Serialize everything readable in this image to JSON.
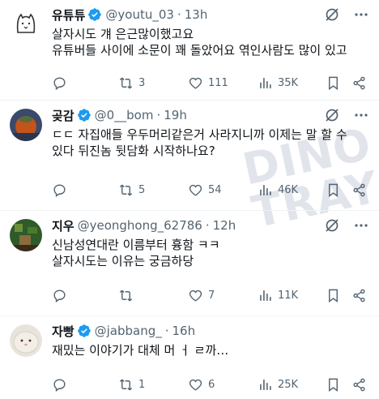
{
  "tweets": [
    {
      "name": "유튜튜",
      "handle": "@youtu_03",
      "time": "13h",
      "lines": [
        "살자시도 걔 은근많이했고요",
        "유튜버들 사이에 소문이 꽤 돌았어요 엮인사람도 많이 있고"
      ],
      "reply_count": "",
      "repost_count": "3",
      "like_count": "111",
      "view_count": "35K"
    },
    {
      "name": "곶감",
      "handle": "@0__bom",
      "time": "19h",
      "lines": [
        "ㄷㄷ 자집애들 우두머리같은거 사라지니까 이제는 말 할 수",
        "있다 뒤진놈 뒷담화 시작하나요?"
      ],
      "reply_count": "",
      "repost_count": "5",
      "like_count": "54",
      "view_count": "46K"
    },
    {
      "name": "지우",
      "handle": "@yeonghong_62786",
      "time": "12h",
      "lines": [
        "신남성연대란 이름부터 흉함 ㅋㅋ",
        "살자시도는 이유는 궁금하당"
      ],
      "reply_count": "",
      "repost_count": "",
      "like_count": "7",
      "view_count": "11K"
    },
    {
      "name": "자빵",
      "handle": "@jabbang_",
      "time": "16h",
      "lines": [
        "재밌는 이야기가 대체 머 ㅓ ㄹ까…"
      ],
      "reply_count": "",
      "repost_count": "1",
      "like_count": "6",
      "view_count": "25K"
    }
  ],
  "separator": "·",
  "colors": {
    "verified": "#1d9bf0",
    "text": "#0f1419",
    "secondary": "#536471",
    "divider": "#eff3f4"
  },
  "icons": [
    "verified-badge-icon",
    "grok-icon",
    "more-icon",
    "reply-icon",
    "repost-icon",
    "like-icon",
    "views-icon",
    "bookmark-icon",
    "share-icon"
  ]
}
